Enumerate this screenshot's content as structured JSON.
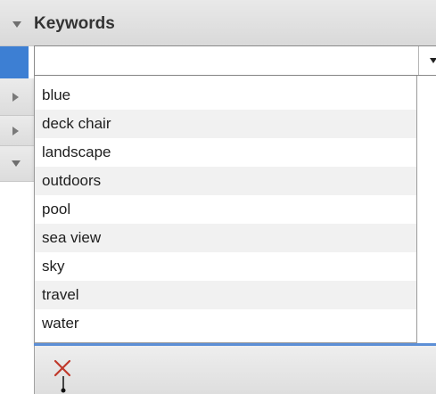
{
  "panel": {
    "title": "Keywords"
  },
  "keyword_field": {
    "value": "",
    "placeholder": ""
  },
  "keyword_options": [
    "blue",
    "deck chair",
    "landscape",
    "outdoors",
    "pool",
    "sea view",
    "sky",
    "travel",
    "water"
  ],
  "colors": {
    "accent_blue": "#3d7fd3",
    "separator_blue": "#5c8fd6",
    "remove_red": "#c0392b"
  },
  "icons": {
    "remove": "x-mark-icon",
    "disclosure_open": "disclosure-triangle-down-icon",
    "disclosure_closed": "disclosure-triangle-right-icon",
    "combo_arrow": "chevron-down-icon"
  }
}
